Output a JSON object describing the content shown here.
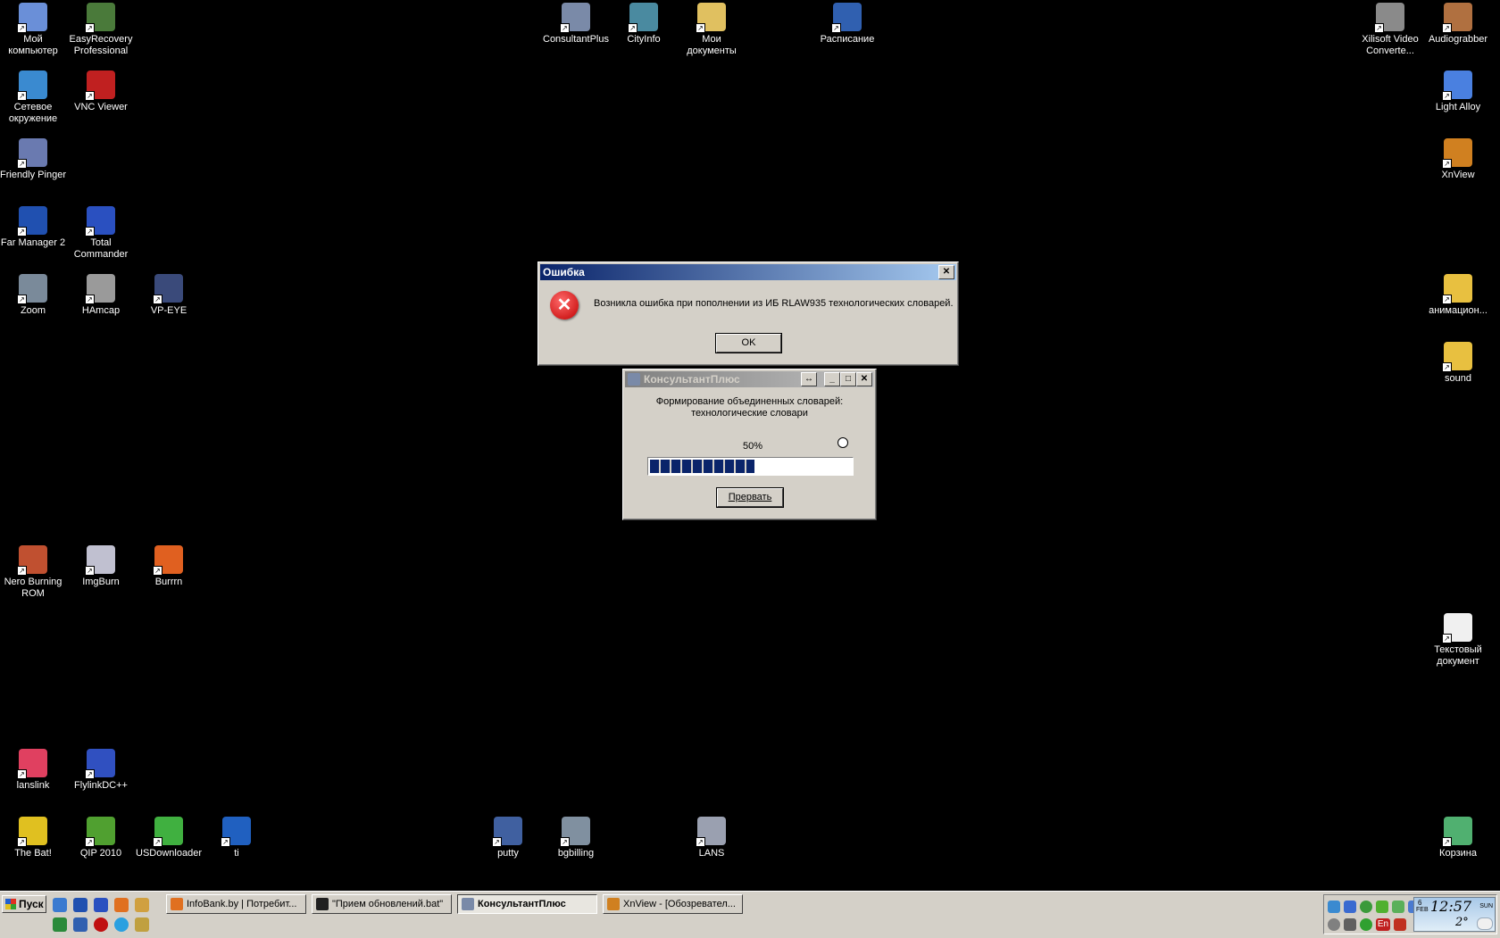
{
  "desktop_icons": [
    {
      "label": "Мой компьютер",
      "icon": "my-computer-icon",
      "color": "#6a8fd8"
    },
    {
      "label": "EasyRecovery Professional",
      "icon": "easyrecovery-icon",
      "color": "#4a7a3a"
    },
    {
      "label": "Сетевое окружение",
      "icon": "network-icon",
      "color": "#3a8ad0"
    },
    {
      "label": "VNC Viewer",
      "icon": "vnc-icon",
      "color": "#c02020"
    },
    {
      "label": "Friendly Pinger",
      "icon": "friendly-pinger-icon",
      "color": "#6a7ab0"
    },
    {
      "label": "Far Manager 2",
      "icon": "far-manager-icon",
      "color": "#2050b0"
    },
    {
      "label": "Total Commander",
      "icon": "total-commander-icon",
      "color": "#2a50c0"
    },
    {
      "label": "Zoom",
      "icon": "zoom-binoculars-icon",
      "color": "#7a8a9a"
    },
    {
      "label": "HAmcap",
      "icon": "hamcap-icon",
      "color": "#9a9a9a"
    },
    {
      "label": "VP-EYE",
      "icon": "vp-eye-icon",
      "color": "#3a4a7a"
    },
    {
      "label": "ConsultantPlus",
      "icon": "consultantplus-icon",
      "color": "#7a8aa8"
    },
    {
      "label": "CityInfo",
      "icon": "cityinfo-icon",
      "color": "#4a8aa0"
    },
    {
      "label": "Мои документы",
      "icon": "my-documents-icon",
      "color": "#e0c060"
    },
    {
      "label": "Расписание",
      "icon": "word-document-icon",
      "color": "#3060b0"
    },
    {
      "label": "Xilisoft Video Converte...",
      "icon": "video-converter-icon",
      "color": "#8a8a8a"
    },
    {
      "label": "Audiograbber",
      "icon": "audiograbber-icon",
      "color": "#b07040"
    },
    {
      "label": "Light Alloy",
      "icon": "light-alloy-icon",
      "color": "#4a80e0"
    },
    {
      "label": "XnView",
      "icon": "xnview-icon",
      "color": "#d08020"
    },
    {
      "label": "анимацион...",
      "icon": "folder-icon",
      "color": "#e8c040"
    },
    {
      "label": "sound",
      "icon": "folder-icon",
      "color": "#e8c040"
    },
    {
      "label": "Nero Burning ROM",
      "icon": "nero-icon",
      "color": "#c05030"
    },
    {
      "label": "ImgBurn",
      "icon": "imgburn-icon",
      "color": "#c0c0d0"
    },
    {
      "label": "Burrrn",
      "icon": "burrrn-icon",
      "color": "#e06020"
    },
    {
      "label": "Текстовый документ",
      "icon": "text-document-icon",
      "color": "#f0f0f0"
    },
    {
      "label": "lanslink",
      "icon": "lanslink-icon",
      "color": "#e04060"
    },
    {
      "label": "FlylinkDC++",
      "icon": "flylinkdc-icon",
      "color": "#3050c0"
    },
    {
      "label": "The Bat!",
      "icon": "the-bat-icon",
      "color": "#e0c020"
    },
    {
      "label": "QIP 2010",
      "icon": "qip-icon",
      "color": "#50a030"
    },
    {
      "label": "USDownloader",
      "icon": "usdownloader-icon",
      "color": "#40b040"
    },
    {
      "label": "ti",
      "icon": "globe-icon",
      "color": "#2060c0"
    },
    {
      "label": "putty",
      "icon": "putty-icon",
      "color": "#4060a0"
    },
    {
      "label": "bgbilling",
      "icon": "bgbilling-icon",
      "color": "#8090a0"
    },
    {
      "label": "LANS",
      "icon": "lans-icon",
      "color": "#9aa0b0"
    },
    {
      "label": "Корзина",
      "icon": "recycle-bin-icon",
      "color": "#50b070"
    }
  ],
  "error_dialog": {
    "title": "Ошибка",
    "message": "Возникла ошибка при пополнении из ИБ RLAW935 технологических словарей.",
    "ok_label": "OK"
  },
  "progress_dialog": {
    "title": "КонсультантПлюс",
    "line1": "Формирование объединенных словарей:",
    "line2": "технологические словари",
    "percent_label": "50%",
    "progress": 0.5,
    "abort_label": "Прервать"
  },
  "taskbar": {
    "start_label": "Пуск",
    "tasks": [
      {
        "label": "InfoBank.by | Потребит...",
        "icon": "firefox-icon",
        "active": false
      },
      {
        "label": "\"Прием обновлений.bat\"",
        "icon": "cmd-icon",
        "active": false
      },
      {
        "label": "КонсультантПлюс",
        "icon": "consultantplus-icon",
        "active": true
      },
      {
        "label": "XnView - [Обозревател...",
        "icon": "xnview-icon",
        "active": false
      }
    ],
    "tray": {
      "lang": "En",
      "time": "12:57",
      "day": "6",
      "month": "FEB",
      "weekday": "SUN",
      "temp": "2°"
    }
  }
}
